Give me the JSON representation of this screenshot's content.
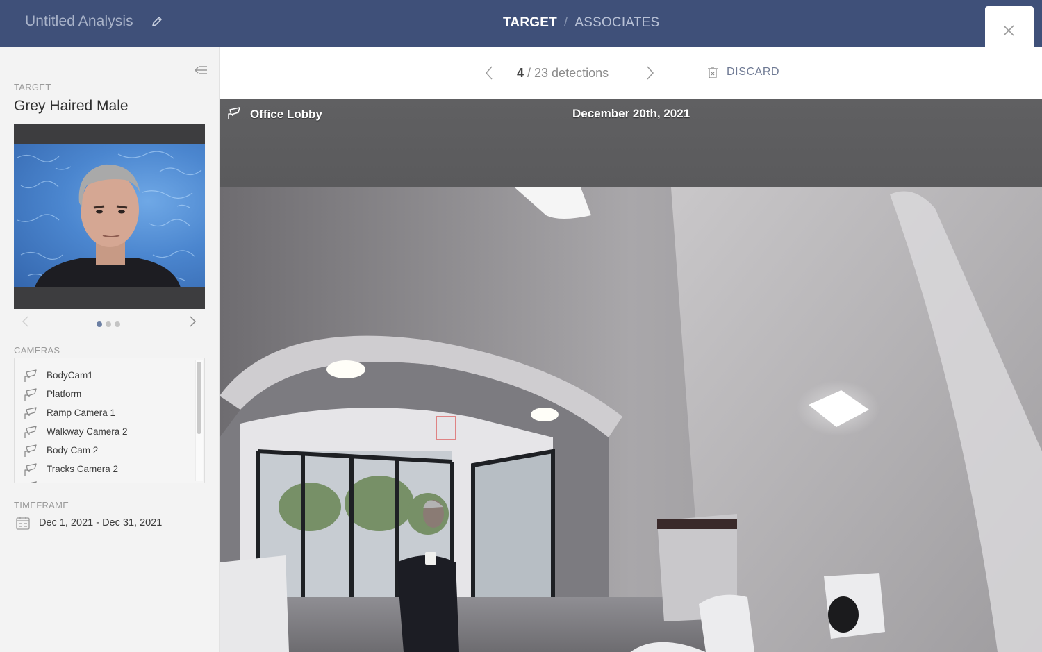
{
  "header": {
    "app_title": "Untitled Analysis",
    "edit_icon": "pencil-icon",
    "breadcrumb": {
      "current": "TARGET",
      "separator": "/",
      "next": "ASSOCIATES"
    },
    "close_icon": "close-icon",
    "colors": {
      "background": "#3f5079",
      "title": "#a9b3c9"
    }
  },
  "sidebar": {
    "collapse_icon": "collapse-sidebar-icon",
    "target_section_label": "TARGET",
    "target_name": "Grey Haired Male",
    "photo_description": "Grey haired man in front of blue water-pattern background",
    "carousel": {
      "total": 3,
      "active_index": 0
    },
    "cameras_label": "CAMERAS",
    "cameras": [
      {
        "label": "BodyCam1",
        "icon": "camera-icon"
      },
      {
        "label": "Platform",
        "icon": "camera-icon"
      },
      {
        "label": "Ramp Camera 1",
        "icon": "camera-icon"
      },
      {
        "label": "Walkway Camera 2",
        "icon": "camera-icon"
      },
      {
        "label": "Body Cam 2",
        "icon": "camera-icon"
      },
      {
        "label": "Tracks Camera 2",
        "icon": "camera-icon"
      }
    ],
    "timeframe_label": "TIMEFRAME",
    "timeframe_value": "Dec 1, 2021 - Dec 31, 2021",
    "timeframe_icon": "calendar-icon"
  },
  "toolbar": {
    "current_detection": "4",
    "detection_suffix": " / 23 detections",
    "total_detections": 23,
    "discard_label": "DISCARD",
    "discard_icon": "trash-icon"
  },
  "viewer": {
    "camera_name": "Office Lobby",
    "date": "December 20th, 2021",
    "scene_description": "Fisheye view of an office lobby with glass doors; a man in a dark suit holding a cup is walking in"
  }
}
